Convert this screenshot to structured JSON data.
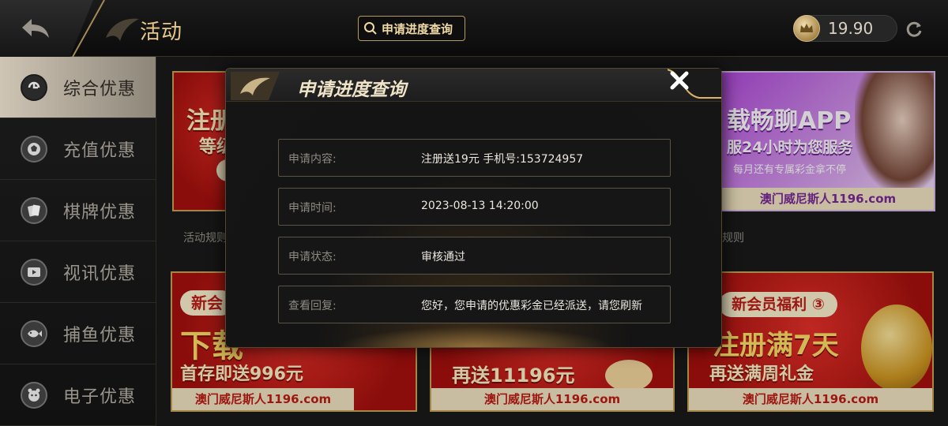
{
  "header": {
    "title": "活动",
    "search_button": "申请进度查询",
    "balance": "19.90"
  },
  "sidebar": {
    "items": [
      {
        "label": "综合优惠",
        "active": true
      },
      {
        "label": "充值优惠",
        "active": false
      },
      {
        "label": "棋牌优惠",
        "active": false
      },
      {
        "label": "视讯优惠",
        "active": false
      },
      {
        "label": "捕鱼优惠",
        "active": false
      },
      {
        "label": "电子优惠",
        "active": false
      }
    ]
  },
  "banners": {
    "top_left": {
      "line1": "注册",
      "line2": "等级"
    },
    "top_right": {
      "line1": "载畅聊APP",
      "line2": "服24小时为您服务",
      "line3": "每月还有专属彩金拿不停",
      "footer": "澳门威尼斯人1196.com"
    },
    "rules_left": "活动规则",
    "rules_right": "规则",
    "bottom_left": {
      "tag": "新会",
      "headline": "下载",
      "sub": "首存即送996元",
      "footer": "澳门威尼斯人1196.com"
    },
    "bottom_mid": {
      "sub": "再送11196元",
      "footer": "澳门威尼斯人1196.com"
    },
    "bottom_right": {
      "tag": "新会员福利 ③",
      "headline": "注册满7天",
      "sub": "再送满周礼金",
      "footer": "澳门威尼斯人1196.com"
    }
  },
  "modal": {
    "title": "申请进度查询",
    "rows": [
      {
        "label": "申请内容:",
        "value": "注册送19元 手机号:153724957"
      },
      {
        "label": "申请时间:",
        "value": "2023-08-13 14:20:00"
      },
      {
        "label": "申请状态:",
        "value": "审核通过"
      },
      {
        "label": "查看回复:",
        "value": "您好，您申请的优惠彩金已经派送，请您刷新"
      }
    ]
  },
  "colors": {
    "gold": "#e8c98a",
    "banner_red": "#c8140f",
    "accent_yellow": "#ffe36a"
  }
}
